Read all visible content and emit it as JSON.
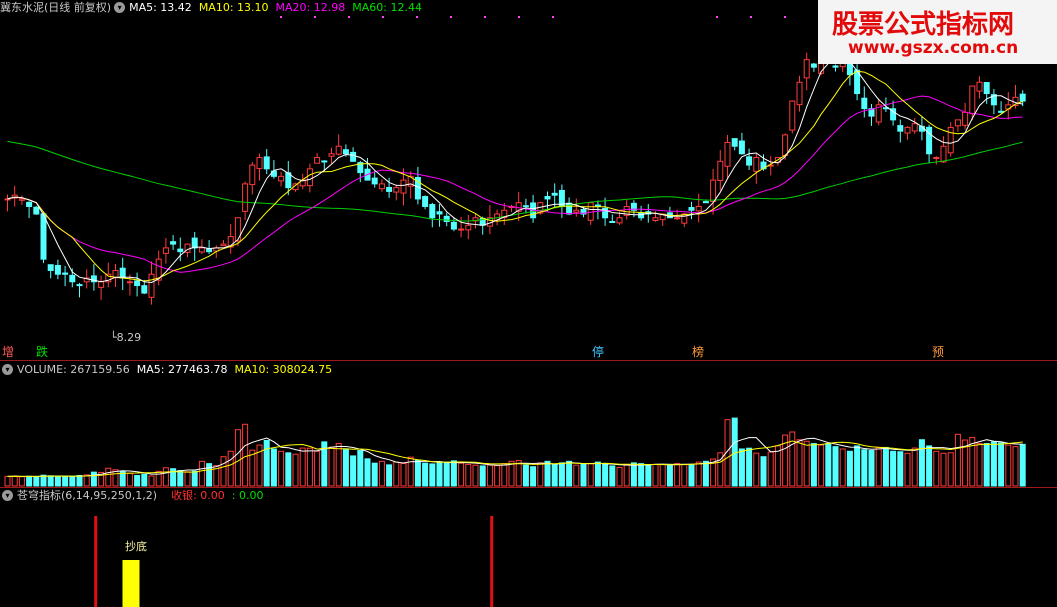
{
  "price_pane": {
    "title": "冀东水泥(日线 前复权)",
    "ma5": "MA5: 13.42",
    "ma10": "MA10: 13.10",
    "ma20": "MA20: 12.98",
    "ma60": "MA60: 12.44",
    "low_label": "8.29",
    "signals": [
      "增",
      "跌",
      "停",
      "榜",
      "预"
    ]
  },
  "volume_pane": {
    "volume": "VOLUME: 267159.56",
    "ma5": "MA5: 277463.78",
    "ma10": "MA10: 308024.75"
  },
  "indicator_pane": {
    "title": "苍穹指标(6,14,95,250,1,2)",
    "close_label": "收银: 0.00",
    "second_label": ": 0.00",
    "buy_label": "抄底"
  },
  "watermark": {
    "title": "股票公式指标网",
    "url": "www.gszx.com.cn"
  },
  "colors": {
    "up": "#ff3b3b",
    "down": "#54ffff",
    "ma5": "#ffffff",
    "ma10": "#ffff00",
    "ma20": "#ff00ff",
    "ma60": "#00d000",
    "buy_bar": "#ffff00",
    "signal_line": "#e01010"
  },
  "chart_data": {
    "type": "candlestick",
    "price_range": [
      7.0,
      15.5
    ],
    "closes": [
      10.8,
      10.9,
      10.8,
      10.6,
      10.4,
      9.2,
      8.9,
      8.8,
      8.8,
      8.6,
      8.5,
      8.7,
      8.6,
      8.6,
      8.8,
      8.9,
      8.7,
      8.6,
      8.5,
      8.3,
      8.8,
      9.2,
      9.5,
      9.6,
      9.4,
      9.6,
      9.5,
      9.5,
      9.4,
      9.5,
      9.6,
      9.8,
      10.3,
      11.2,
      11.7,
      11.9,
      11.6,
      11.4,
      11.4,
      11.1,
      11.2,
      11.3,
      11.6,
      11.9,
      11.8,
      12.0,
      12.2,
      12.0,
      11.8,
      11.5,
      11.3,
      11.2,
      11.2,
      11.0,
      11.1,
      11.3,
      11.4,
      10.8,
      10.6,
      10.3,
      10.4,
      10.2,
      10.0,
      10.0,
      10.1,
      10.3,
      10.1,
      10.3,
      10.4,
      10.5,
      10.6,
      10.7,
      10.6,
      10.3,
      10.7,
      10.8,
      10.9,
      10.6,
      10.4,
      10.5,
      10.4,
      10.7,
      10.6,
      10.3,
      10.2,
      10.3,
      10.6,
      10.5,
      10.3,
      10.4,
      10.3,
      10.4,
      10.3,
      10.3,
      10.4,
      10.5,
      10.6,
      10.7,
      11.3,
      11.8,
      12.3,
      12.2,
      12.0,
      11.7,
      11.9,
      11.6,
      11.7,
      11.9,
      12.5,
      13.4,
      13.9,
      14.5,
      14.3,
      14.8,
      14.5,
      14.3,
      14.5,
      14.1,
      13.6,
      13.2,
      13.0,
      13.3,
      13.2,
      12.9,
      12.6,
      12.7,
      12.8,
      12.6,
      12.0,
      11.9,
      12.2,
      12.7,
      12.9,
      13.1,
      13.8,
      13.9,
      13.6,
      13.3,
      13.1,
      13.3,
      13.5,
      13.4
    ],
    "volume_range": [
      0,
      700000
    ],
    "volumes": [
      62000,
      65000,
      60000,
      63000,
      61000,
      70000,
      66000,
      64000,
      62000,
      60000,
      68000,
      72000,
      90000,
      88000,
      115000,
      105000,
      95000,
      82000,
      68000,
      76000,
      65000,
      95000,
      118000,
      112000,
      100000,
      92000,
      96000,
      160000,
      145000,
      132000,
      190000,
      225000,
      365000,
      400000,
      232000,
      265000,
      295000,
      240000,
      225000,
      215000,
      206000,
      246000,
      245000,
      225000,
      286000,
      252000,
      276000,
      240000,
      195000,
      230000,
      176000,
      148000,
      160000,
      137000,
      155000,
      146000,
      187000,
      166000,
      148000,
      143000,
      150000,
      155000,
      163000,
      148000,
      140000,
      135000,
      130000,
      135000,
      132000,
      145000,
      160000,
      165000,
      135000,
      125000,
      150000,
      160000,
      140000,
      150000,
      160000,
      135000,
      140000,
      145000,
      155000,
      140000,
      130000,
      120000,
      135000,
      150000,
      145000,
      135000,
      140000,
      140000,
      140000,
      145000,
      140000,
      140000,
      155000,
      160000,
      175000,
      215000,
      430000,
      440000,
      240000,
      245000,
      213000,
      190000,
      220000,
      260000,
      330000,
      350000,
      300000,
      290000,
      275000,
      265000,
      275000,
      255000,
      240000,
      225000,
      260000,
      235000,
      230000,
      248000,
      250000,
      225000,
      222000,
      212000,
      246000,
      300000,
      260000,
      225000,
      212000,
      215000,
      335000,
      298000,
      315000,
      276000,
      275000,
      285000,
      280000,
      265000,
      255000,
      270000
    ],
    "buy_signal_index": 20,
    "signal_line_indices": [
      16,
      71
    ]
  }
}
